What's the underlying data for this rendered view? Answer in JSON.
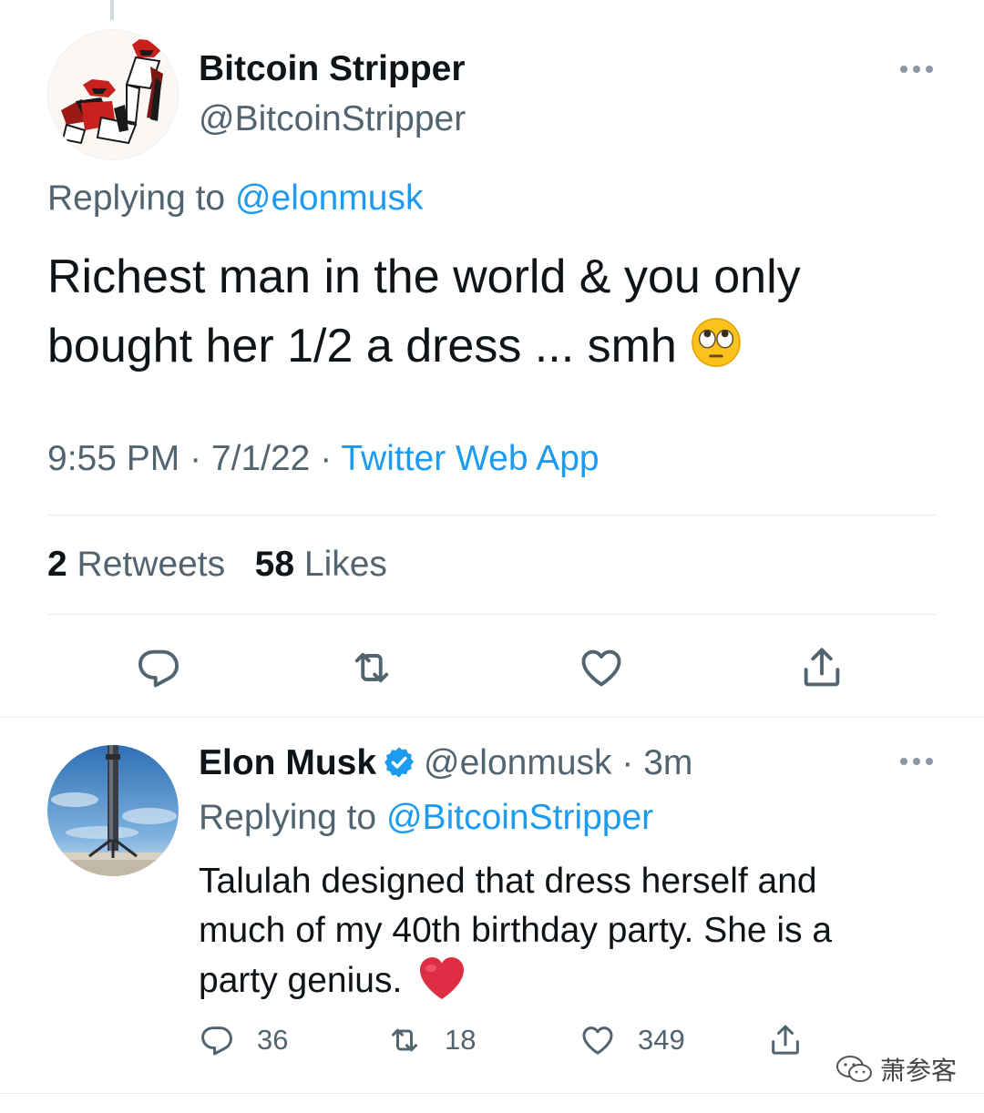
{
  "main_tweet": {
    "author_name": "Bitcoin Stripper",
    "author_handle": "@BitcoinStripper",
    "replying_prefix": "Replying to",
    "replying_handle": "@elonmusk",
    "text_line1": "Richest man in the world & you only",
    "text_line2": "bought her 1/2 a dress ... smh",
    "text_emoji": "face-with-rolling-eyes-emoji",
    "time": "9:55 PM",
    "date": "7/1/22",
    "separator": "·",
    "client": "Twitter Web App",
    "retweets_count": "2",
    "retweets_label": "Retweets",
    "likes_count": "58",
    "likes_label": "Likes",
    "actions": [
      "reply-icon",
      "retweet-icon",
      "like-icon",
      "share-icon"
    ]
  },
  "reply_tweet": {
    "author_name": "Elon Musk",
    "author_handle": "@elonmusk",
    "separator": "·",
    "time_ago": "3m",
    "replying_prefix": "Replying to",
    "replying_handle": "@BitcoinStripper",
    "text_line1": "Talulah designed that dress herself and",
    "text_line2": "much of my 40th birthday party. She is a",
    "text_line3": "party genius.",
    "text_emoji": "red-heart-emoji",
    "reply_count": "36",
    "retweet_count": "18",
    "like_count": "349"
  },
  "watermark": {
    "text": "萧参客"
  },
  "colors": {
    "text_primary": "#0f1419",
    "text_secondary": "#536471",
    "link": "#1d9bf0",
    "verified": "#1d9bf0",
    "divider": "#e6ecf0"
  }
}
